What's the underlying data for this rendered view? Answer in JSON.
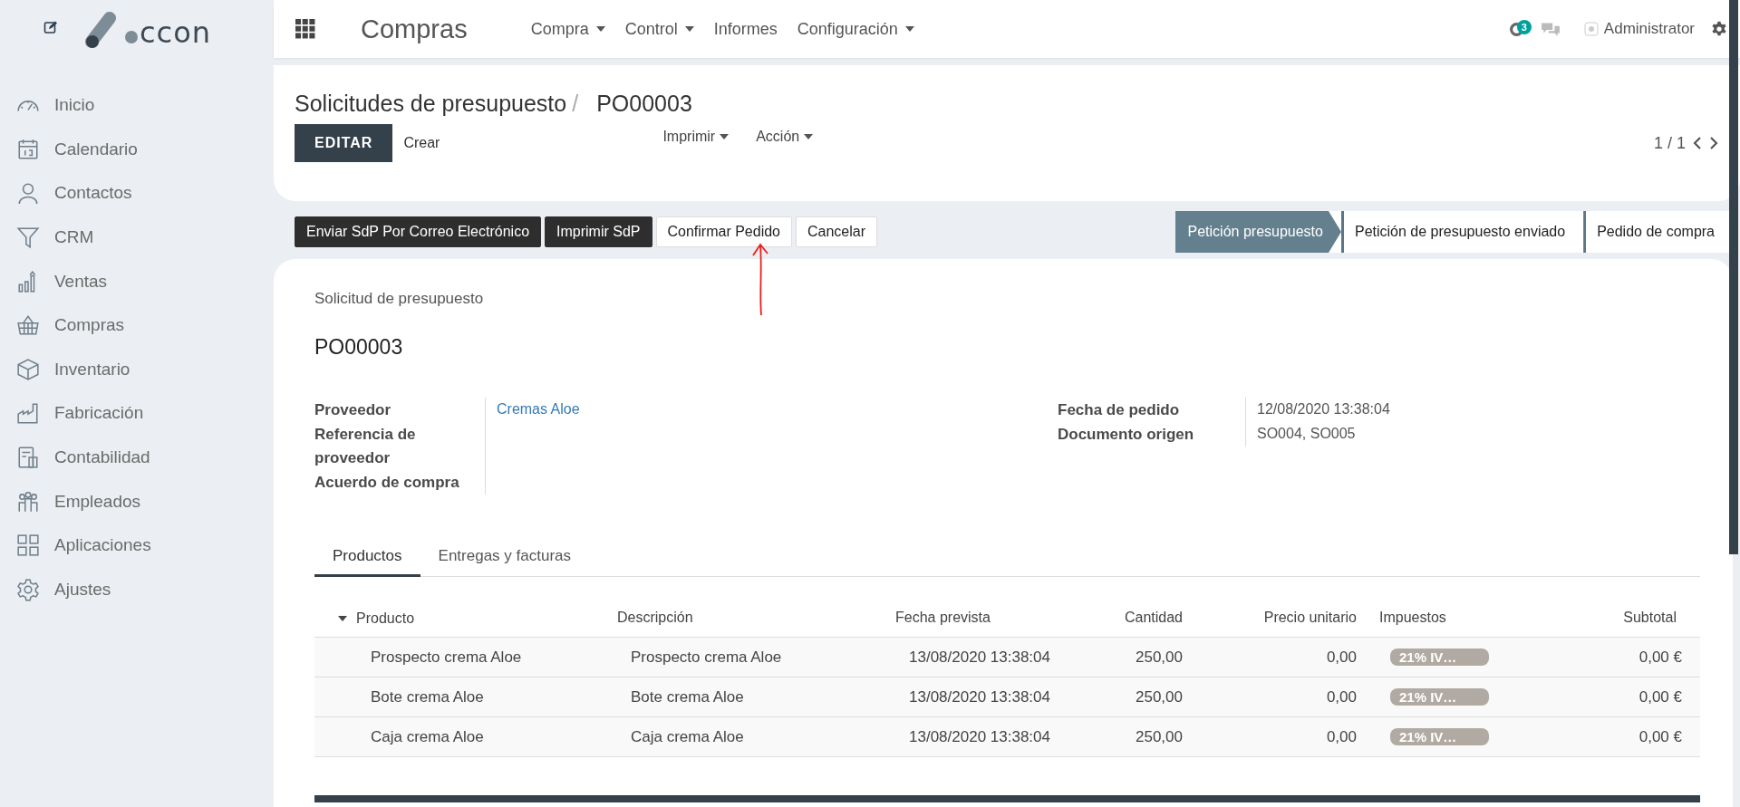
{
  "logo": {
    "text": "ccon"
  },
  "sidebar": {
    "items": [
      {
        "label": "Inicio"
      },
      {
        "label": "Calendario"
      },
      {
        "label": "Contactos"
      },
      {
        "label": "CRM"
      },
      {
        "label": "Ventas"
      },
      {
        "label": "Compras"
      },
      {
        "label": "Inventario"
      },
      {
        "label": "Fabricación"
      },
      {
        "label": "Contabilidad"
      },
      {
        "label": "Empleados"
      },
      {
        "label": "Aplicaciones"
      },
      {
        "label": "Ajustes"
      }
    ]
  },
  "topbar": {
    "app_title": "Compras",
    "menu": [
      {
        "label": "Compra",
        "dropdown": true
      },
      {
        "label": "Control",
        "dropdown": true
      },
      {
        "label": "Informes",
        "dropdown": false
      },
      {
        "label": "Configuración",
        "dropdown": true
      }
    ],
    "activity_count": "3",
    "user": "Administrator"
  },
  "breadcrumb": {
    "parent": "Solicitudes de presupuesto",
    "separator": "/",
    "current": "PO00003"
  },
  "control_panel": {
    "primary_button": "EDITAR",
    "secondary_button": "Crear",
    "dropdowns": [
      "Imprimir",
      "Acción"
    ],
    "pager": "1 / 1"
  },
  "action_buttons": [
    {
      "label": "Enviar SdP Por Correo Electrónico",
      "kind": "dark"
    },
    {
      "label": "Imprimir SdP",
      "kind": "dark"
    },
    {
      "label": "Confirmar Pedido",
      "kind": "light"
    },
    {
      "label": "Cancelar",
      "kind": "light"
    }
  ],
  "status_steps": [
    {
      "label": "Petición presupuesto",
      "selected": true
    },
    {
      "label": "Petición de presupuesto enviado",
      "selected": false
    },
    {
      "label": "Pedido de compra",
      "selected": false
    }
  ],
  "annotation": {
    "kind": "arrow"
  },
  "form": {
    "subtitle": "Solicitud de presupuesto",
    "name": "PO00003",
    "left_fields": [
      {
        "label": "Proveedor",
        "value": "Cremas Aloe",
        "kind": "link"
      },
      {
        "label": "Referencia de proveedor"
      },
      {
        "label": "Acuerdo de compra"
      }
    ],
    "right_fields": [
      {
        "label": "Fecha de pedido",
        "value": "12/08/2020 13:38:04",
        "kind": "text"
      },
      {
        "label": "Documento origen",
        "value": "SO004, SO005",
        "kind": "text"
      }
    ]
  },
  "tabs": [
    {
      "label": "Productos",
      "selected": true
    },
    {
      "label": "Entregas y facturas",
      "selected": false
    }
  ],
  "table": {
    "columns": [
      "Producto",
      "Descripción",
      "Fecha prevista",
      "Cantidad",
      "Precio unitario",
      "Impuestos",
      "Subtotal"
    ],
    "rows": [
      [
        "Prospecto crema Aloe",
        "Prospecto crema Aloe",
        "13/08/2020 13:38:04",
        "250,00",
        "0,00",
        "21% IV…",
        "0,00 €"
      ],
      [
        "Bote crema Aloe",
        "Bote crema Aloe",
        "13/08/2020 13:38:04",
        "250,00",
        "0,00",
        "21% IV…",
        "0,00 €"
      ],
      [
        "Caja crema Aloe",
        "Caja crema Aloe",
        "13/08/2020 13:38:04",
        "250,00",
        "0,00",
        "21% IV…",
        "0,00 €"
      ]
    ]
  }
}
